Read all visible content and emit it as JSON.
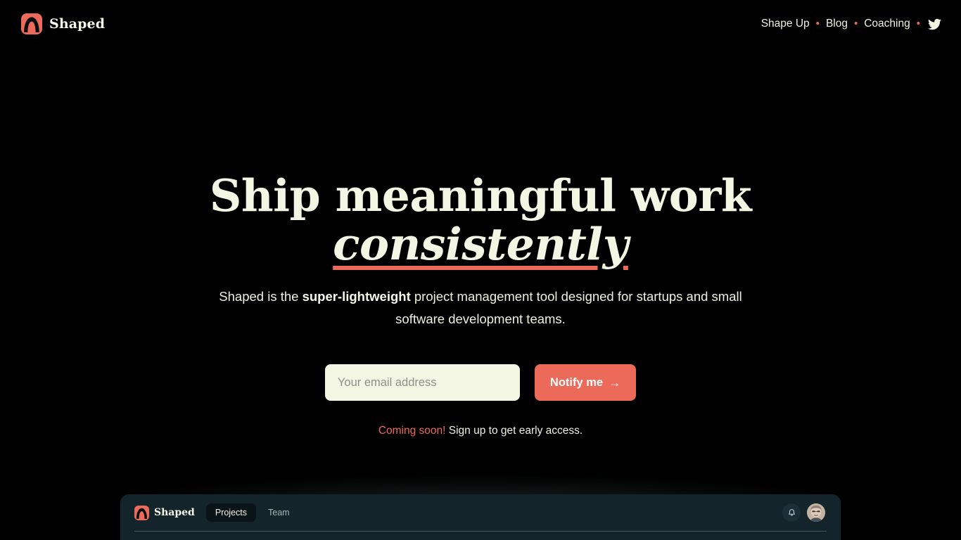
{
  "colors": {
    "background": "#000000",
    "accent": "#EC6A5A",
    "cream": "#F4F6E4",
    "app_panel": "#13252B",
    "app_tab_active": "#0A1317"
  },
  "topnav": {
    "brand_name": "Shaped",
    "brand_logo_icon": "shaped-logo-icon",
    "links": [
      {
        "label": "Shape Up"
      },
      {
        "label": "Blog"
      },
      {
        "label": "Coaching"
      }
    ],
    "separator": "•",
    "twitter_icon": "twitter-bird-icon"
  },
  "hero": {
    "headline_line1": "Ship meaningful work",
    "headline_line2_emphasis": "consistently",
    "subhead_before": "Shaped is the ",
    "subhead_bold": "super-lightweight",
    "subhead_after": " project management tool designed for startups and small software development teams."
  },
  "signup": {
    "email_placeholder": "Your email address",
    "email_value": "",
    "notify_label": "Notify me",
    "notify_arrow": "→",
    "note_accent": "Coming soon!",
    "note_rest": " Sign up to get early access."
  },
  "app_preview": {
    "brand_name": "Shaped",
    "brand_logo_icon": "shaped-logo-icon",
    "tabs": [
      {
        "label": "Projects",
        "active": true
      },
      {
        "label": "Team",
        "active": false
      }
    ],
    "bell_icon": "bell-icon",
    "avatar_icon": "user-avatar"
  }
}
